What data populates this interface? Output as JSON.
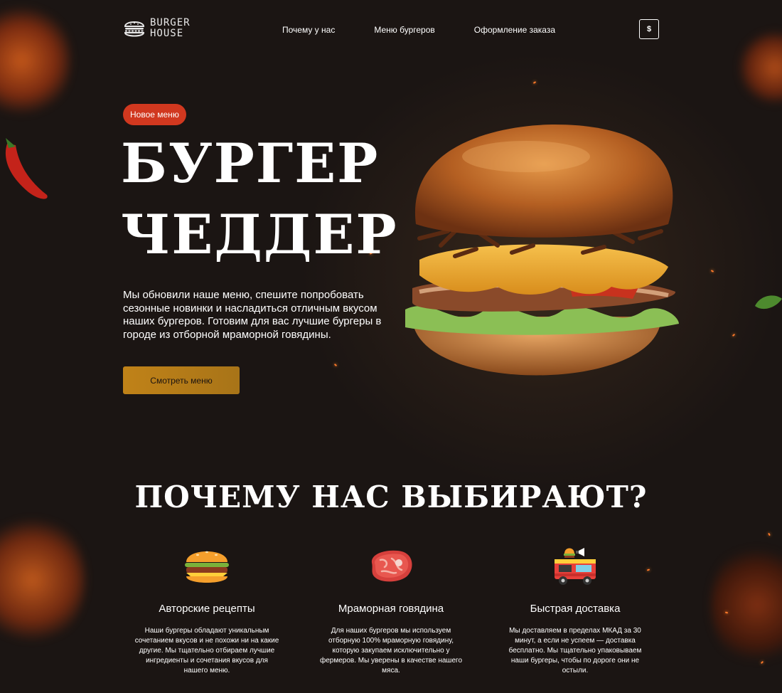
{
  "header": {
    "logo_line1": "BURGER",
    "logo_line2": "HOUSE",
    "nav": [
      "Почему у нас",
      "Меню бургеров",
      "Оформление заказа"
    ],
    "currency_button": "$"
  },
  "hero": {
    "badge": "Новое меню",
    "title_line1": "БУРГЕР",
    "title_line2": "ЧЕДДЕР",
    "description": "Мы обновили наше меню, спешите попробовать сезонные новинки и насладиться отличным вкусом наших бургеров. Готовим для вас лучшие бургеры в городе из отборной мраморной говядины.",
    "cta_label": "Смотреть меню"
  },
  "why": {
    "title": "ПОЧЕМУ НАС ВЫБИРАЮТ?",
    "features": [
      {
        "icon": "burger-icon",
        "title": "Авторские рецепты",
        "text": "Наши бургеры обладают уникальным сочетанием вкусов и не похожи ни на какие другие. Мы тщательно отбираем лучшие ингредиенты и сочетания вкусов для нашего меню."
      },
      {
        "icon": "steak-icon",
        "title": "Мраморная говядина",
        "text": "Для наших бургеров мы используем отборную 100% мраморную говядину, которую закупаем исключительно у фермеров. Мы уверены в качестве нашего мяса."
      },
      {
        "icon": "food-truck-icon",
        "title": "Быстрая доставка",
        "text": "Мы доставляем в пределах МКАД за 30 минут, а если не успеем — доставка бесплатно. Мы тщательно упаковываем наши бургеры, чтобы по дороге они не остыли."
      }
    ]
  },
  "colors": {
    "background": "#1b1513",
    "badge": "#d1381f",
    "cta": "#b57c18"
  }
}
